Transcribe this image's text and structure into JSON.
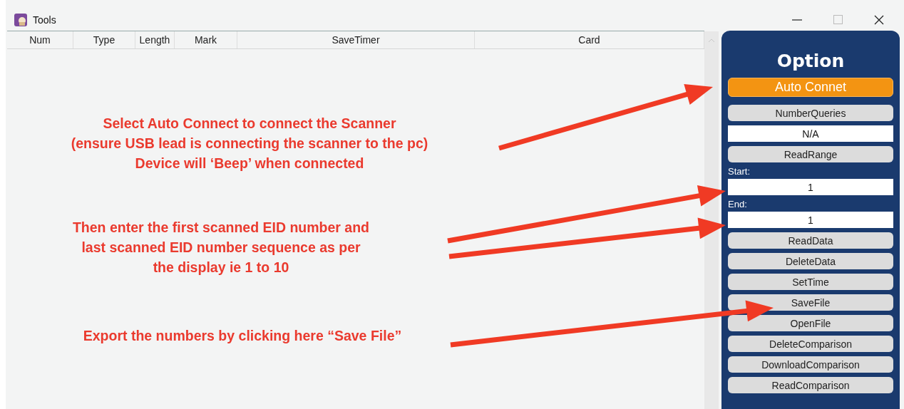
{
  "window": {
    "title": "Tools"
  },
  "table": {
    "columns": [
      "Num",
      "Type",
      "Length",
      "Mark",
      "SaveTimer",
      "Card"
    ]
  },
  "annotations": [
    {
      "lines": [
        "Select Auto Connect to connect the Scanner",
        "(ensure USB lead is connecting the scanner to the pc)",
        "Device will ‘Beep’ when connected"
      ]
    },
    {
      "lines": [
        "Then enter the first scanned EID number and",
        "last scanned EID number sequence as per",
        "the display ie 1 to 10"
      ]
    },
    {
      "lines": [
        "Export the numbers by clicking here “Save File”"
      ]
    }
  ],
  "panel": {
    "title": "Option",
    "items": [
      {
        "kind": "accent",
        "label": "Auto Connet"
      },
      {
        "kind": "button",
        "label": "NumberQueries"
      },
      {
        "kind": "field",
        "value": "N/A"
      },
      {
        "kind": "button",
        "label": "ReadRange"
      },
      {
        "kind": "label",
        "label": "Start:"
      },
      {
        "kind": "field",
        "value": "1"
      },
      {
        "kind": "label",
        "label": "End:"
      },
      {
        "kind": "field",
        "value": "1"
      },
      {
        "kind": "button",
        "label": "ReadData"
      },
      {
        "kind": "button",
        "label": "DeleteData"
      },
      {
        "kind": "button",
        "label": "SetTime"
      },
      {
        "kind": "button",
        "label": "SaveFile"
      },
      {
        "kind": "button",
        "label": "OpenFile"
      },
      {
        "kind": "button",
        "label": "DeleteComparison"
      },
      {
        "kind": "button",
        "label": "DownloadComparison"
      },
      {
        "kind": "button",
        "label": "ReadComparison"
      }
    ]
  }
}
